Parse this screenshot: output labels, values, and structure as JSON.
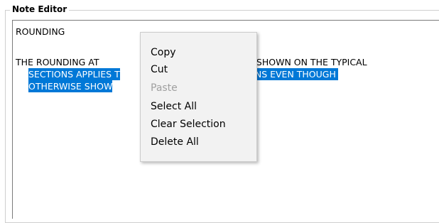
{
  "groupbox": {
    "title": "Note Editor"
  },
  "editor": {
    "lines": [
      "ROUNDING",
      "",
      "THE ROUNDING AT",
      "S SHOWN ON THE TYPICAL",
      "SECTIONS APPLIES T",
      "ONS EVEN THOUGH",
      "OTHERWISE SHOW"
    ]
  },
  "context_menu": {
    "items": [
      {
        "label": "Copy",
        "enabled": true
      },
      {
        "label": "Cut",
        "enabled": true
      },
      {
        "label": "Paste",
        "enabled": false
      },
      {
        "label": "Select All",
        "enabled": true
      },
      {
        "label": "Clear Selection",
        "enabled": true
      },
      {
        "label": "Delete All",
        "enabled": true
      }
    ]
  },
  "colors": {
    "selection": "#0078d7",
    "menu_background": "#f2f2f2",
    "disabled_text": "#a0a0a0"
  }
}
